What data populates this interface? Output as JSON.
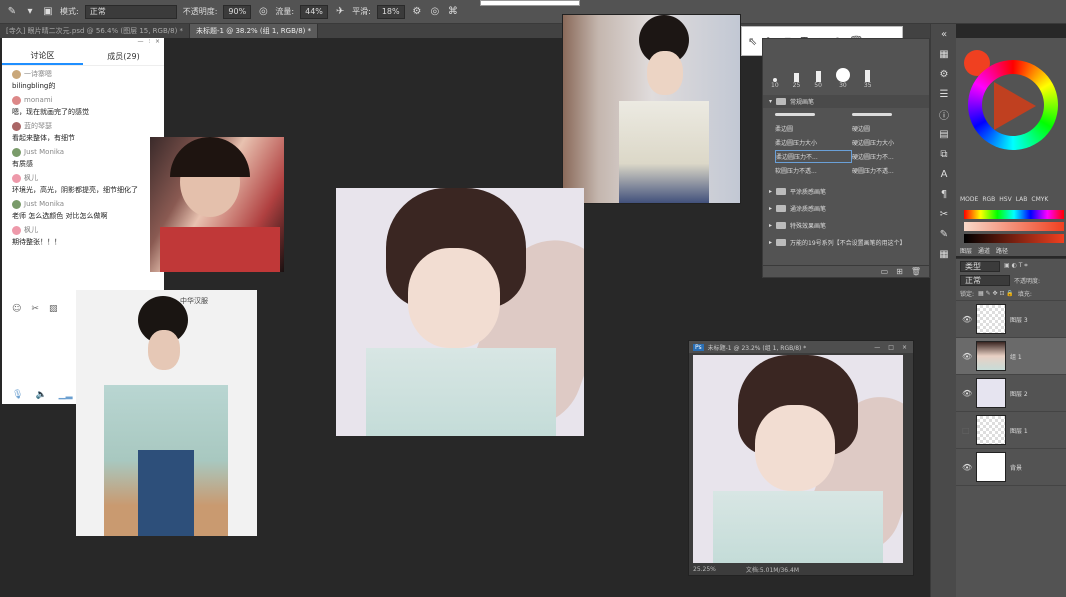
{
  "options_bar": {
    "mode_label": "模式:",
    "mode_value": "正常",
    "opacity_label": "不透明度:",
    "opacity_value": "90%",
    "flow_label": "流量:",
    "flow_value": "44%",
    "smooth_label": "平滑:",
    "smooth_value": "18%"
  },
  "tabs": [
    {
      "label": "[寺久] 眼片晴二次元.psd @ 56.4% (图层 15, RGB/8) *"
    },
    {
      "label": "未标题-1 @ 38.2% (组 1, RGB/8) *"
    }
  ],
  "chat": {
    "tab_discussion": "讨论区",
    "tab_members": "成员(29)",
    "messages": [
      {
        "user": "一诗寨嗯",
        "text": "bilingbling的",
        "color": "#c9a77a"
      },
      {
        "user": "monami",
        "text": "嗯，现在就画完了的感觉",
        "color": "#d88"
      },
      {
        "user": "蓝的琴瑟",
        "text": "看起来整体，有细节",
        "color": "#a66"
      },
      {
        "user": "Just Monika",
        "text": "有质感",
        "color": "#7a9b6a"
      },
      {
        "user": "枫儿",
        "text": "环境光，高光，阴影都提亮，细节细化了",
        "color": "#e9a"
      },
      {
        "user": "Just Monika",
        "text": "老师 怎么选颜色 对比怎么做啊",
        "color": "#7a9b6a"
      },
      {
        "user": "枫儿",
        "text": "期待整张！！！",
        "color": "#e9a"
      }
    ]
  },
  "photo_caption": "中华汉服",
  "brush_panel": {
    "sizes": [
      "10",
      "25",
      "50",
      "30",
      "35"
    ],
    "groups": [
      {
        "name": "常规画笔",
        "open": true
      },
      {
        "name": "平涂质感画笔",
        "open": false
      },
      {
        "name": "通涂质感画笔",
        "open": false
      },
      {
        "name": "特殊效果画笔",
        "open": false
      },
      {
        "name": "万能的19号系列【不合设置画笔的用这个】",
        "open": false
      }
    ],
    "brushes": [
      "柔边圆",
      "硬边圆",
      "柔边圆压力大小",
      "硬边圆压力大小",
      "柔边圆压力不...",
      "硬边圆压力不...",
      "软圆压力不透...",
      "硬圆压力不透..."
    ]
  },
  "color_panel": {
    "modes": [
      "MODE",
      "RGB",
      "HSV",
      "LAB",
      "CMYK"
    ],
    "tabs": [
      "图层",
      "通道",
      "路径"
    ]
  },
  "layers_panel": {
    "kind_label": "类型",
    "blend": "正常",
    "opacity_label": "不透明度:",
    "lock_label": "锁定:",
    "fill_label": "填充:",
    "layers": [
      {
        "name": "图层 3",
        "selected": false
      },
      {
        "name": "组 1",
        "selected": true
      },
      {
        "name": "图层 2",
        "selected": false
      },
      {
        "name": "图层 1",
        "selected": false
      },
      {
        "name": "背景",
        "selected": false
      }
    ]
  },
  "float_window": {
    "title": "未标题-1 @ 23.2% (组 1, RGB/8) *",
    "zoom": "25.25%",
    "doc_info": "文档:5.01M/36.4M"
  },
  "colors": {
    "foreground": "#f04020",
    "accent": "#1f8fff"
  }
}
